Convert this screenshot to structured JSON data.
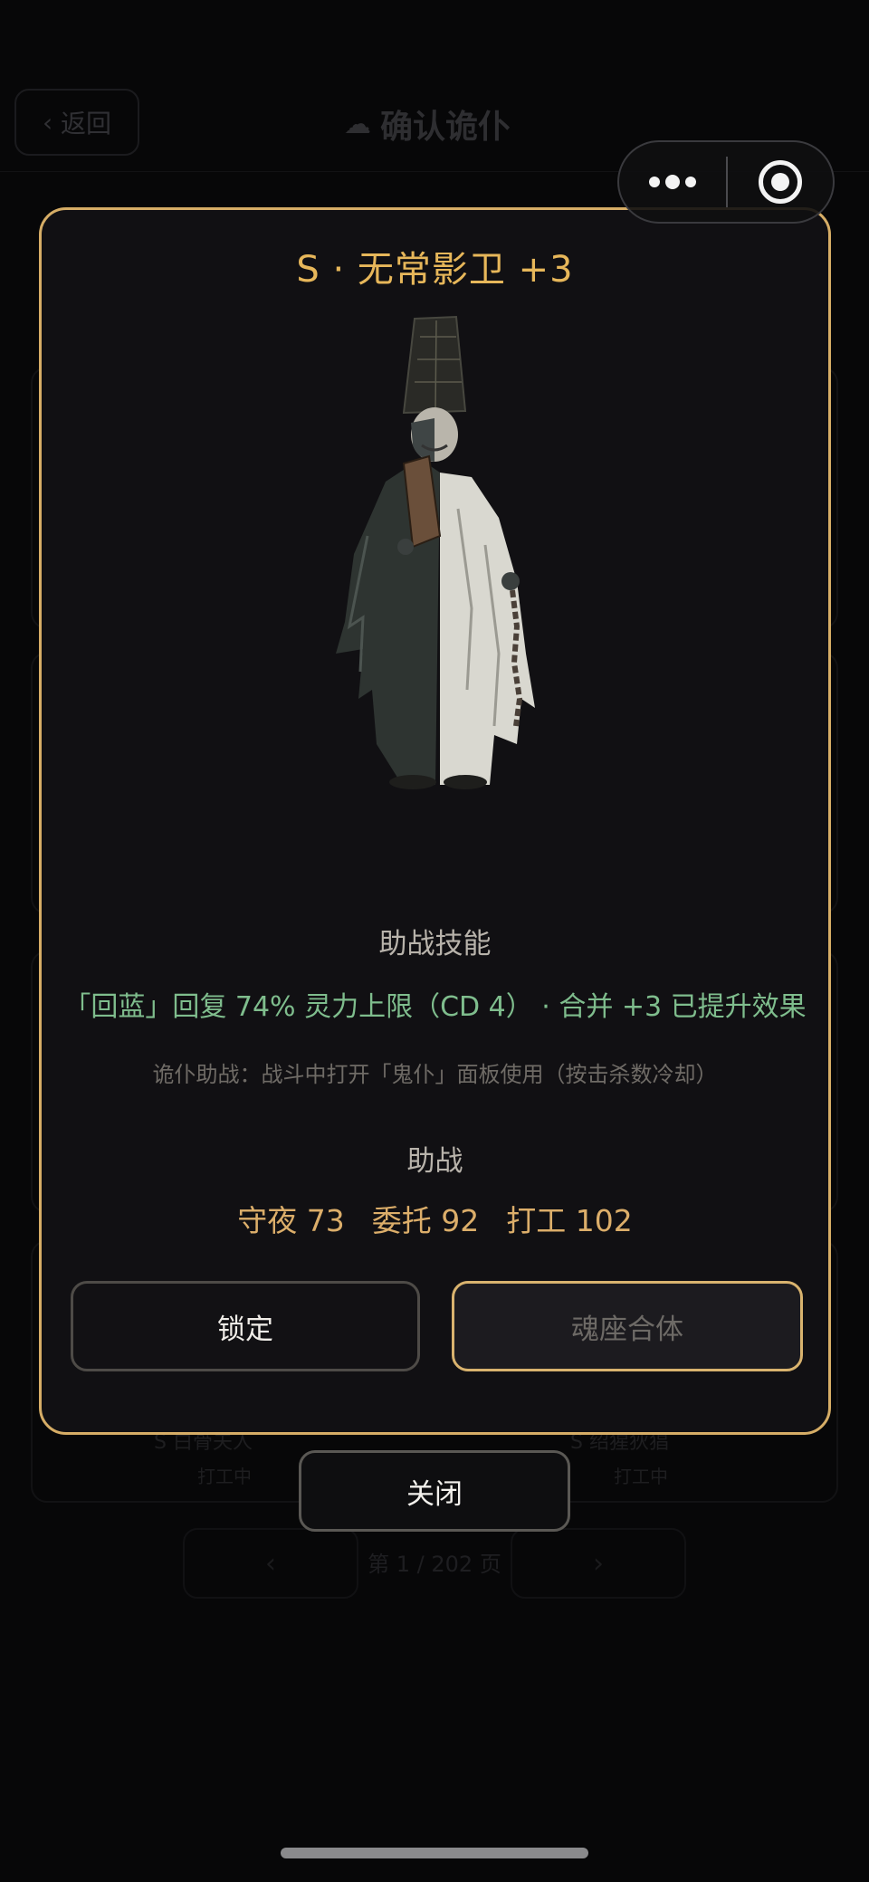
{
  "background": {
    "back_label": "返回",
    "page_title": "确认诡仆",
    "rows": [
      {
        "left": "S  白骨夫人",
        "left_status": "打工中",
        "right": "S  绍猩狄猖",
        "right_status": "打工中"
      }
    ],
    "pager": {
      "prev": "‹",
      "next": "›",
      "text": "第 1 / 202 页"
    }
  },
  "capsule": {
    "more_icon": "more-dots-icon",
    "close_icon": "target-circle-icon"
  },
  "modal": {
    "title": "S · 无常影卫 +3",
    "figure_icon": "ghost-servant-figure",
    "skill_section_label": "助战技能",
    "skill_text": "「回蓝」回复 74% 灵力上限（CD 4） · 合并 +3 已提升效果",
    "hint_text": "诡仆助战：战斗中打开「鬼仆」面板使用（按击杀数冷却）",
    "assist_section_label": "助战",
    "stats": [
      {
        "label": "守夜",
        "value": "73"
      },
      {
        "label": "委托",
        "value": "92"
      },
      {
        "label": "打工",
        "value": "102"
      }
    ],
    "lock_label": "锁定",
    "merge_label": "魂座合体"
  },
  "close_label": "关闭",
  "colors": {
    "gold": "#d6ad66",
    "title_gold": "#e7b75a",
    "skill_green": "#7fbd8d",
    "modal_bg": "#111013"
  }
}
